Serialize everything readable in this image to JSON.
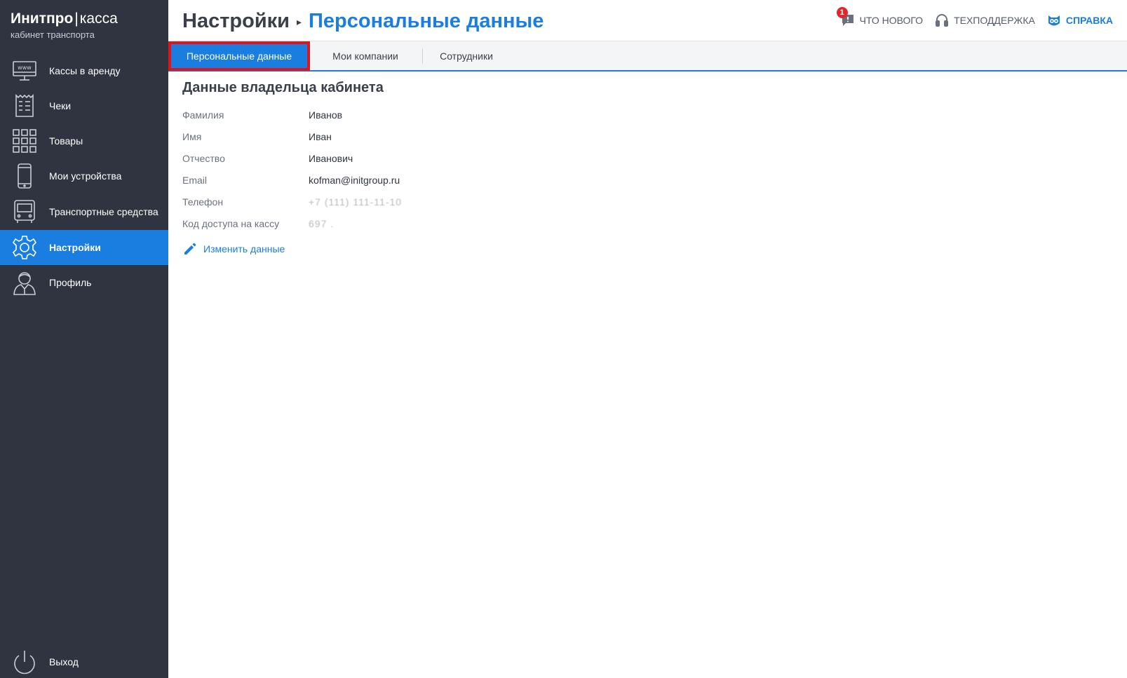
{
  "brand": {
    "name": "Инитпро",
    "separator": "|",
    "product": "касса",
    "subtitle": "кабинет транспорта"
  },
  "sidebar": {
    "items": [
      {
        "label": "Кассы в аренду",
        "icon": "www-monitor-icon"
      },
      {
        "label": "Чеки",
        "icon": "receipt-icon"
      },
      {
        "label": "Товары",
        "icon": "grid-icon"
      },
      {
        "label": "Мои устройства",
        "icon": "phone-icon"
      },
      {
        "label": "Транспортные средства",
        "icon": "bus-icon"
      },
      {
        "label": "Настройки",
        "icon": "gear-icon",
        "active": true
      },
      {
        "label": "Профиль",
        "icon": "user-icon"
      }
    ],
    "logout_label": "Выход"
  },
  "header": {
    "breadcrumb_parent": "Настройки",
    "breadcrumb_current": "Персональные данные",
    "whats_new": {
      "label": "ЧТО НОВОГО",
      "badge": "1"
    },
    "support_label": "ТЕХПОДДЕРЖКА",
    "help_label": "СПРАВКА"
  },
  "tabs": [
    {
      "label": "Персональные данные",
      "active": true
    },
    {
      "label": "Мои компании"
    },
    {
      "label": "Сотрудники"
    }
  ],
  "owner": {
    "title": "Данные владельца кабинета",
    "fields": [
      {
        "label": "Фамилия",
        "value": "Иванов"
      },
      {
        "label": "Имя",
        "value": "Иван"
      },
      {
        "label": "Отчество",
        "value": "Иванович"
      },
      {
        "label": "Email",
        "value": "kofman@initgroup.ru"
      },
      {
        "label": "Телефон",
        "value": "+7 (111) 111-11-10"
      },
      {
        "label": "Код доступа на кассу",
        "value": "697 ."
      }
    ],
    "edit_label": "Изменить данные"
  },
  "colors": {
    "sidebar_bg": "#2f3440",
    "accent": "#1a7de0",
    "highlight_border": "#e0141c",
    "badge": "#e4252a"
  }
}
